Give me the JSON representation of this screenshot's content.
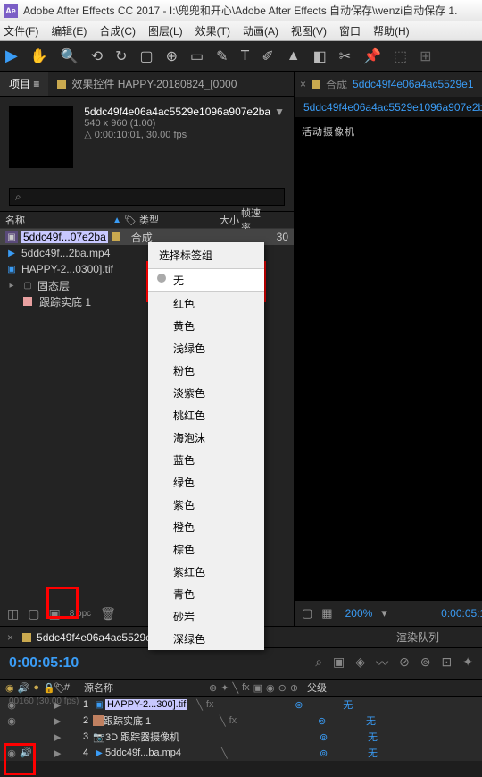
{
  "title": "Adobe After Effects CC 2017 - I:\\兜兜和开心\\Adobe After Effects 自动保存\\wenzi自动保存 1.",
  "ae_logo": "Ae",
  "menu": {
    "file": "文件(F)",
    "edit": "编辑(E)",
    "comp": "合成(C)",
    "layer": "图层(L)",
    "effect": "效果(T)",
    "anim": "动画(A)",
    "view": "视图(V)",
    "window": "窗口",
    "help": "帮助(H)"
  },
  "project": {
    "tab1": "项目",
    "tab1_menu": "≡",
    "tab2": "效果控件 HAPPY-20180824_[0000",
    "info_name": "5ddc49f4e06a4ac5529e1096a907e2ba",
    "caret": "▼",
    "info_dim": "540 x 960 (1.00)",
    "info_dur": "△ 0:00:10:01, 30.00 fps",
    "search_icon": "⌕",
    "cols": {
      "name": "名称",
      "tag": "🏷",
      "type": "类型",
      "size": "大小",
      "fps": "帧速率"
    },
    "rows": [
      {
        "icon": "▣",
        "label": "gold",
        "name": "5ddc49f...07e2ba",
        "type": "合成",
        "fps": "30",
        "sel": true
      },
      {
        "icon": "▶",
        "label": "",
        "name": "5ddc49f...2ba.mp4"
      },
      {
        "icon": "▣",
        "label": "",
        "name": "HAPPY-2...0300].tif"
      },
      {
        "icon": "▸",
        "label": "",
        "name": "固态层",
        "folder": true
      },
      {
        "icon": "",
        "label": "peach",
        "name": "跟踪实底 1",
        "indent": true
      }
    ],
    "foot_bpc": "8 bpc"
  },
  "ctx": {
    "title": "选择标签组",
    "items": [
      "无",
      "红色",
      "黄色",
      "浅绿色",
      "粉色",
      "淡紫色",
      "桃红色",
      "海泡沫",
      "蓝色",
      "绿色",
      "紫色",
      "橙色",
      "棕色",
      "紫红色",
      "青色",
      "砂岩",
      "深绿色"
    ]
  },
  "comp": {
    "close": "×",
    "label": "合成",
    "name": "5ddc49f4e06a4ac5529e1",
    "subtitle": "5ddc49f4e06a4ac5529e1096a907e2b",
    "viewer": "活动摄像机",
    "zoom": "200%",
    "time": "0:00:05:1"
  },
  "timeline": {
    "tab_x": "×",
    "tab_name": "5ddc49f4e06a4ac5529e1096a907e2ba",
    "render": "渲染队列",
    "timecode": "0:00:05:10",
    "frames": "00160 (30.00 fps)",
    "cols": {
      "src": "源名称",
      "parent": "父级"
    },
    "layers": [
      {
        "num": "1",
        "label": "lav",
        "icon": "▣",
        "name": "HAPPY-2...300].tif",
        "hl": true,
        "parent": "无",
        "fx": true,
        "eye": true
      },
      {
        "num": "2",
        "label": "peach",
        "icon": "■",
        "name": "跟踪实底 1",
        "parent": "无",
        "fx": true,
        "eye": true
      },
      {
        "num": "3",
        "label": "blue",
        "icon": "📷",
        "name": "3D 跟踪器摄像机",
        "parent": "无",
        "eye": false
      },
      {
        "num": "4",
        "label": "lav",
        "icon": "▶",
        "name": "5ddc49f...ba.mp4",
        "parent": "无",
        "eye": true,
        "spk": true
      }
    ]
  }
}
